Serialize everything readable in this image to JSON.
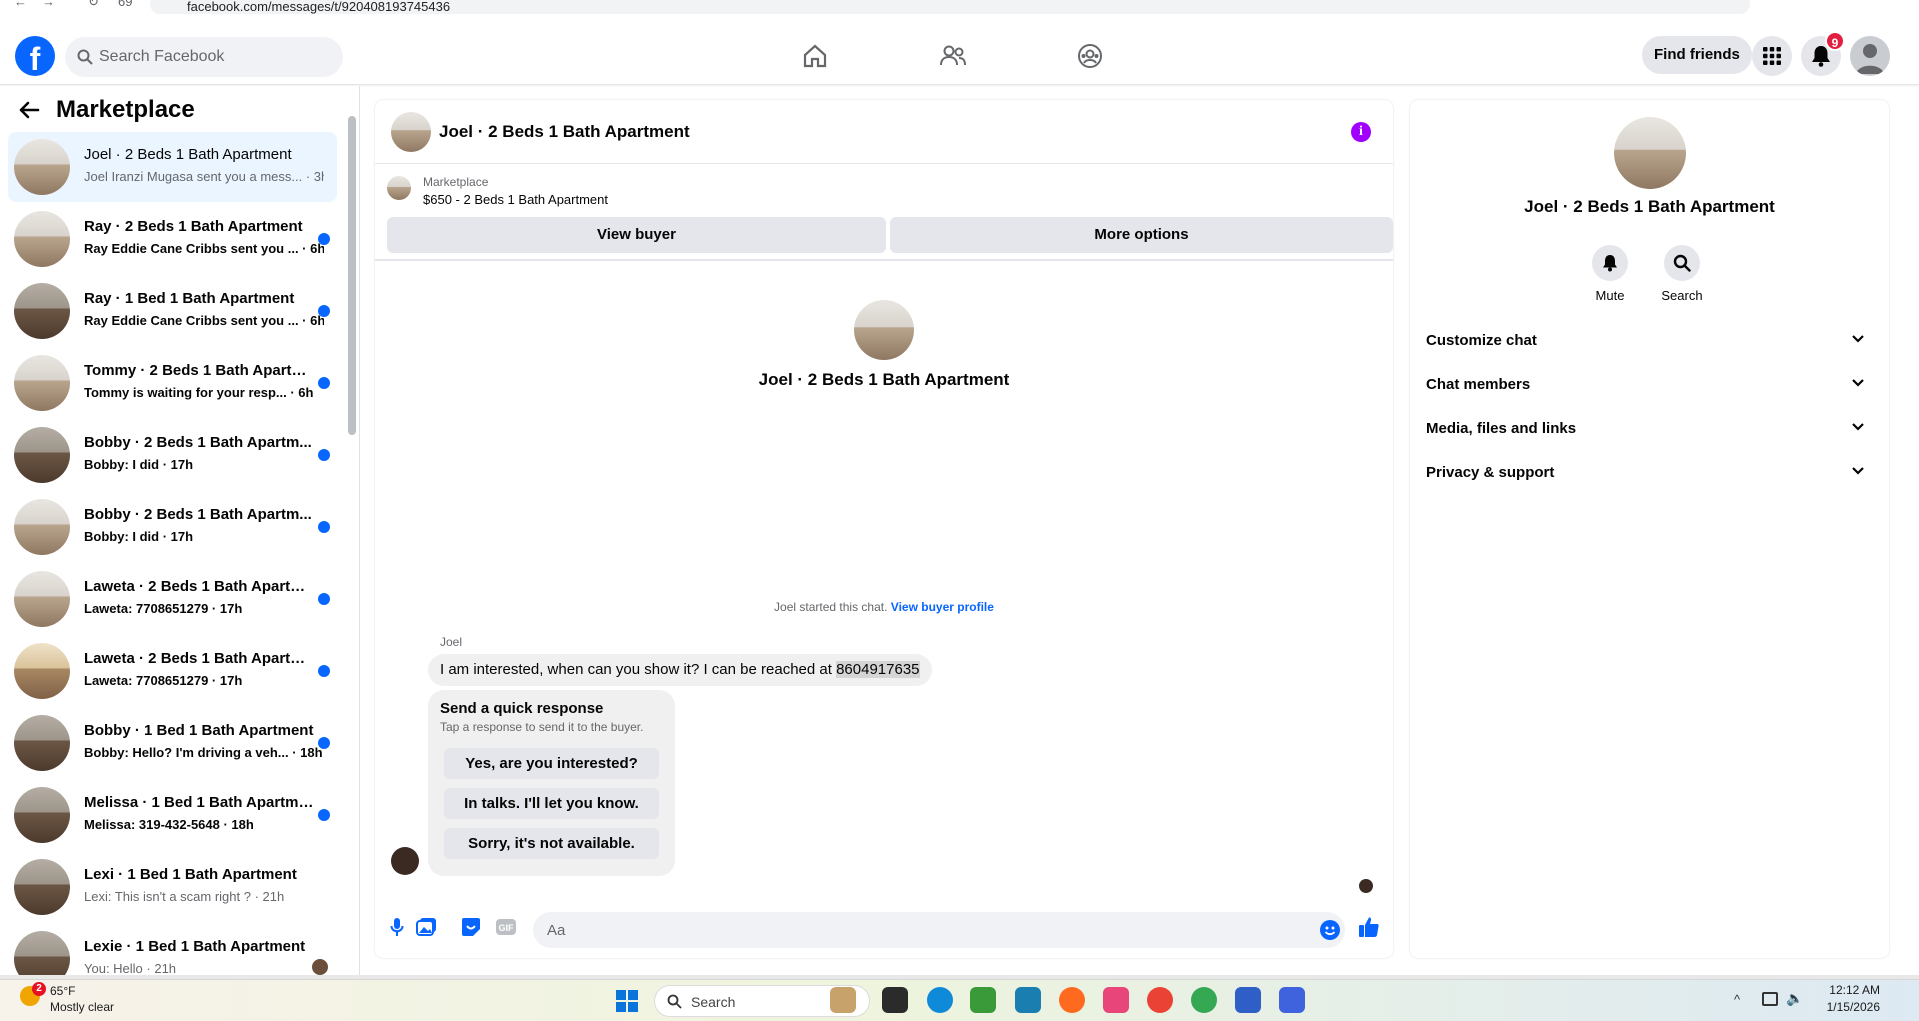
{
  "browser": {
    "url": "facebook.com/messages/t/920408193745436",
    "nav_number": "69"
  },
  "header": {
    "search_placeholder": "Search Facebook",
    "find_friends": "Find friends",
    "notification_count": "9"
  },
  "sidebar": {
    "title": "Marketplace",
    "conversations": [
      {
        "name": "Joel · 2 Beds 1 Bath Apartment",
        "preview": "Joel Iranzi Mugasa sent you a mess... · 3h",
        "unread": false,
        "active": true
      },
      {
        "name": "Ray · 2 Beds 1 Bath Apartment",
        "preview": "Ray Eddie Cane Cribbs sent you ... · 6h",
        "unread": true
      },
      {
        "name": "Ray · 1 Bed 1 Bath Apartment",
        "preview": "Ray Eddie Cane Cribbs sent you ... · 6h",
        "unread": true
      },
      {
        "name": "Tommy · 2 Beds 1 Bath Apartm...",
        "preview": "Tommy is waiting for your resp... · 6h",
        "unread": true
      },
      {
        "name": "Bobby · 2 Beds 1 Bath Apartm...",
        "preview": "Bobby: I did · 17h",
        "unread": true
      },
      {
        "name": "Bobby · 2 Beds 1 Bath Apartm...",
        "preview": "Bobby: I did · 17h",
        "unread": true
      },
      {
        "name": "Laweta · 2 Beds 1 Bath Apartm...",
        "preview": "Laweta: 7708651279 · 17h",
        "unread": true
      },
      {
        "name": "Laweta · 2 Beds 1 Bath Apartm...",
        "preview": "Laweta: 7708651279 · 17h",
        "unread": true
      },
      {
        "name": "Bobby · 1 Bed 1 Bath Apartment",
        "preview": "Bobby: Hello? I'm driving a veh... · 18h",
        "unread": true
      },
      {
        "name": "Melissa · 1 Bed 1 Bath Apartme...",
        "preview": "Melissa: 319-432-5648 · 18h",
        "unread": true
      },
      {
        "name": "Lexi · 1 Bed 1 Bath Apartment",
        "preview": "Lexi: This isn't a scam right ? · 21h",
        "unread": false
      },
      {
        "name": "Lexie · 1 Bed 1 Bath Apartment",
        "preview": "You: Hello · 21h",
        "unread": false
      }
    ]
  },
  "chat": {
    "title": "Joel · 2 Beds 1 Bath Apartment",
    "listing_category": "Marketplace",
    "listing_title": "$650 - 2 Beds 1 Bath Apartment",
    "view_buyer": "View buyer",
    "more_options": "More options",
    "intro_name": "Joel · 2 Beds 1 Bath Apartment",
    "started_text": "Joel started this chat.",
    "view_buyer_profile": "View buyer profile",
    "sender": "Joel",
    "message_text": "I am interested, when can you show it?  I can be reached at ",
    "message_phone": "8604917635",
    "quick_title": "Send a quick response",
    "quick_subtitle": "Tap a response to send it to the buyer.",
    "quick_responses": [
      "Yes, are you interested?",
      "In talks. I'll let you know.",
      "Sorry, it's not available."
    ],
    "input_placeholder": "Aa"
  },
  "details": {
    "name": "Joel · 2 Beds 1 Bath Apartment",
    "mute": "Mute",
    "search": "Search",
    "sections": [
      "Customize chat",
      "Chat members",
      "Media, files and links",
      "Privacy & support"
    ]
  },
  "taskbar": {
    "weather_temp": "65°F",
    "weather_desc": "Mostly clear",
    "weather_badge": "2",
    "search": "Search",
    "time": "12:12 AM",
    "date": "1/15/2026"
  },
  "colors": {
    "accent": "#0866ff",
    "info": "#a100ff",
    "badge": "#e41e3f"
  }
}
